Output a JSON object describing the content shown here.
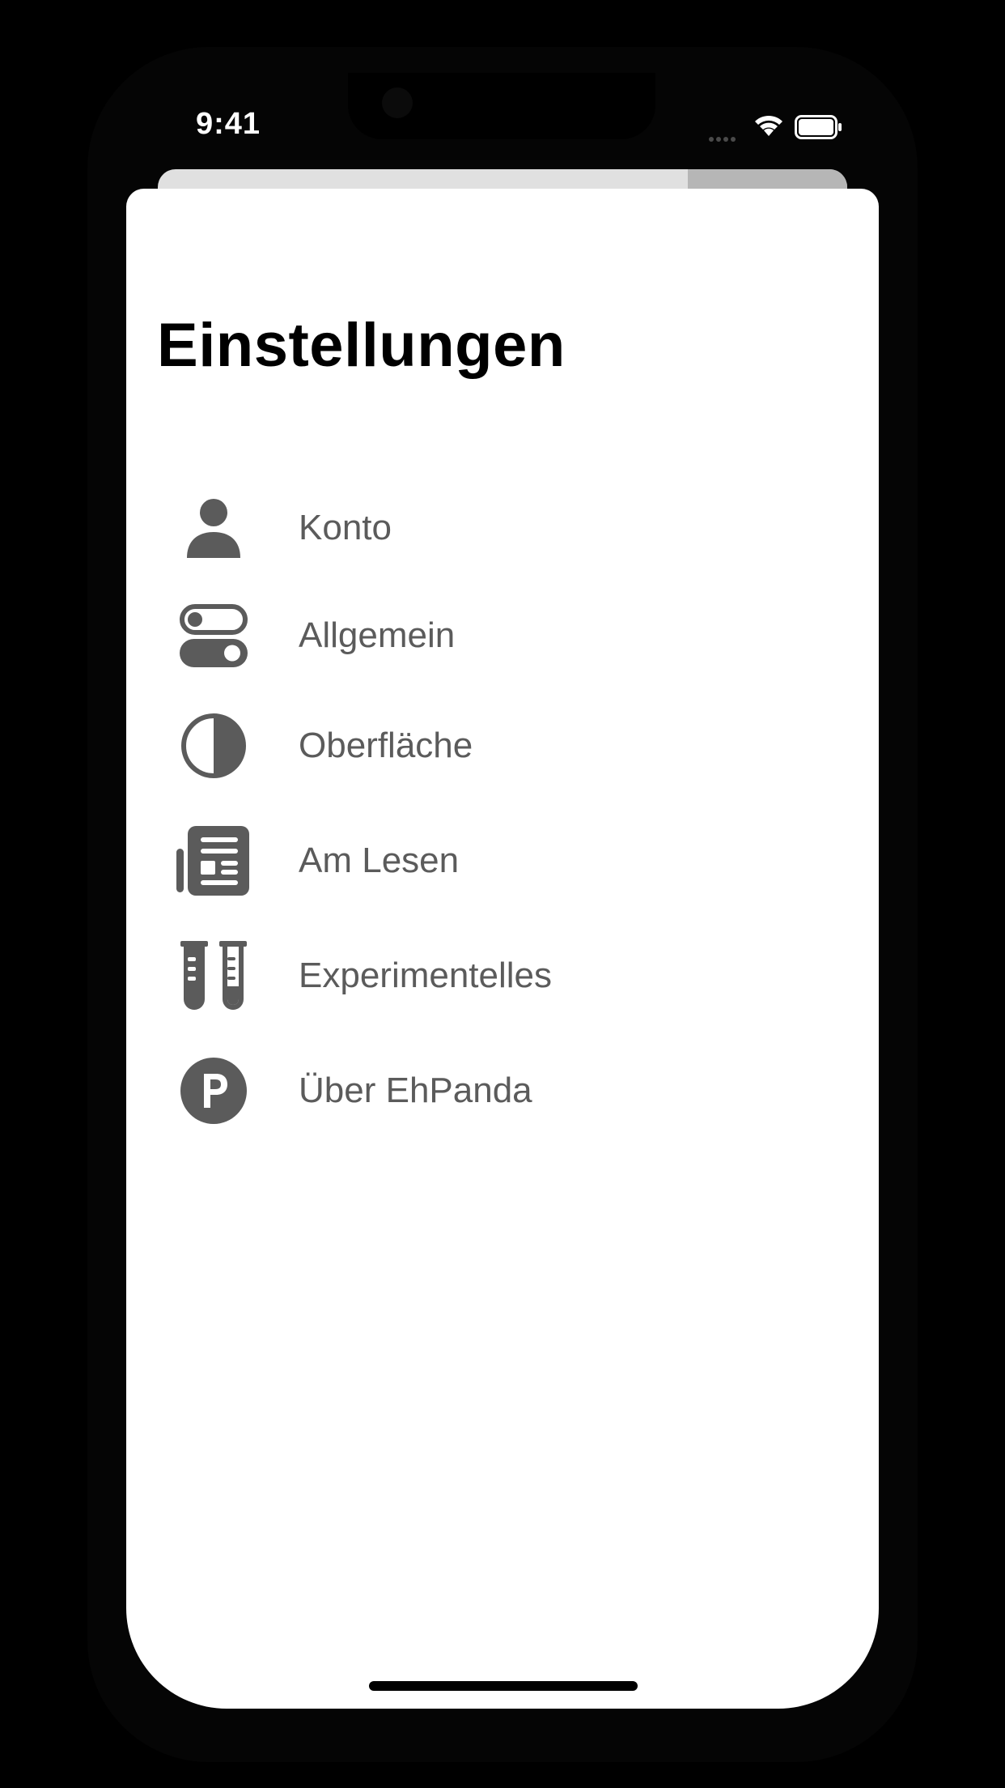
{
  "status_bar": {
    "time": "9:41"
  },
  "page": {
    "title": "Einstellungen"
  },
  "menu": {
    "items": [
      {
        "icon": "person-icon",
        "label": "Konto"
      },
      {
        "icon": "switches-icon",
        "label": "Allgemein"
      },
      {
        "icon": "half-circle-icon",
        "label": "Oberfläche"
      },
      {
        "icon": "newspaper-icon",
        "label": "Am Lesen"
      },
      {
        "icon": "test-tubes-icon",
        "label": "Experimentelles"
      },
      {
        "icon": "p-circle-icon",
        "label": "Über EhPanda"
      }
    ]
  },
  "colors": {
    "background": "#000000",
    "sheet": "#ffffff",
    "icon": "#5b5b5b",
    "label": "#5b5b5b",
    "title": "#000000"
  }
}
